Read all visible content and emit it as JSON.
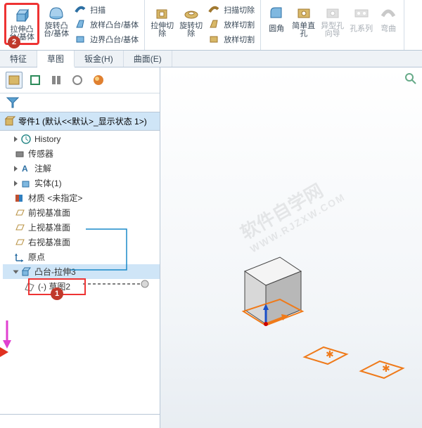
{
  "ribbon": {
    "extrude": "拉伸凸台/基体",
    "revolve": "旋转凸台/基体",
    "sweep": "扫描",
    "loft": "放样凸台/基体",
    "boundary": "边界凸台/基体",
    "cut_extrude_l1": "拉伸切",
    "cut_extrude_l2": "除",
    "cut_revolve_l1": "旋转切",
    "cut_revolve_l2": "除",
    "cut_sweep": "扫描切除",
    "cut_loft": "放样切割",
    "cut_boundary": "放样切割",
    "fillet": "圆角",
    "hole_simple_l1": "简单直",
    "hole_simple_l2": "孔",
    "hole_wizard_l1": "异型孔",
    "hole_wizard_l2": "向导",
    "hole_series": "孔系列",
    "bend": "弯曲"
  },
  "tabs": {
    "feature": "特征",
    "sketch": "草图",
    "sheetmetal": "钣金(H)",
    "surface": "曲面(E)"
  },
  "part_title": "零件1  (默认<<默认>_显示状态 1>)",
  "tree": {
    "history": "History",
    "sensor": "传感器",
    "annot": "注解",
    "solid": "实体(1)",
    "material": "材质 <未指定>",
    "front": "前视基准面",
    "top": "上视基准面",
    "right": "右视基准面",
    "origin": "原点",
    "extrude3": "凸台-拉伸3",
    "sketch2": "(-) 草图2"
  },
  "badges": {
    "b1": "1",
    "b2": "2"
  },
  "watermark": {
    "main": "软件自学网",
    "sub": "WWW.RJZXW.COM"
  }
}
